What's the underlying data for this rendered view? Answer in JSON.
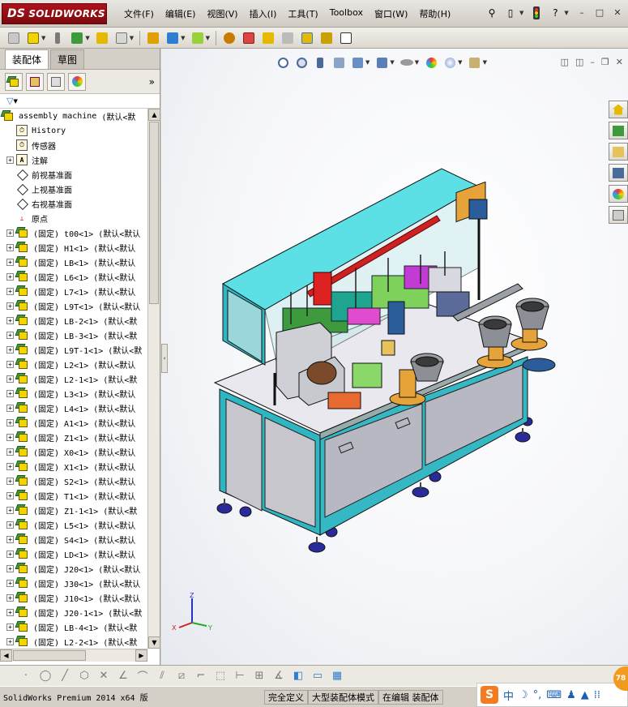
{
  "app": {
    "brand": "SOLIDWORKS",
    "brand_prefix": "DS"
  },
  "menu": [
    "文件(F)",
    "编辑(E)",
    "视图(V)",
    "插入(I)",
    "工具(T)",
    "Toolbox",
    "窗口(W)",
    "帮助(H)"
  ],
  "window_buttons": [
    "–",
    "□",
    "✕"
  ],
  "tabs": [
    {
      "label": "装配体",
      "active": true
    },
    {
      "label": "草图",
      "active": false
    }
  ],
  "tree": {
    "root": {
      "name": "assembly machine",
      "config": "(默认<默"
    },
    "items": [
      {
        "kind": "folder",
        "expand": false,
        "label": "History"
      },
      {
        "kind": "folder",
        "expand": false,
        "label": "传感器"
      },
      {
        "kind": "annot",
        "expand": true,
        "label": "注解"
      },
      {
        "kind": "plane",
        "expand": false,
        "label": "前视基准面"
      },
      {
        "kind": "plane",
        "expand": false,
        "label": "上视基准面"
      },
      {
        "kind": "plane",
        "expand": false,
        "label": "右视基准面"
      },
      {
        "kind": "origin",
        "expand": false,
        "label": "原点"
      },
      {
        "kind": "part",
        "expand": true,
        "label": "(固定) t00<1> (默认<默认"
      },
      {
        "kind": "part",
        "expand": true,
        "label": "(固定) H1<1> (默认<默认"
      },
      {
        "kind": "part",
        "expand": true,
        "label": "(固定) LB<1> (默认<默认"
      },
      {
        "kind": "part",
        "expand": true,
        "label": "(固定) L6<1> (默认<默认"
      },
      {
        "kind": "part",
        "expand": true,
        "label": "(固定) L7<1> (默认<默认"
      },
      {
        "kind": "part",
        "expand": true,
        "label": "(固定) L9T<1> (默认<默认"
      },
      {
        "kind": "part",
        "expand": true,
        "label": "(固定) LB-2<1> (默认<默"
      },
      {
        "kind": "part",
        "expand": true,
        "label": "(固定) LB-3<1> (默认<默"
      },
      {
        "kind": "part",
        "expand": true,
        "label": "(固定) L9T-1<1> (默认<默"
      },
      {
        "kind": "part",
        "expand": true,
        "label": "(固定) L2<1> (默认<默认"
      },
      {
        "kind": "part",
        "expand": true,
        "label": "(固定) L2-1<1> (默认<默"
      },
      {
        "kind": "part",
        "expand": true,
        "label": "(固定) L3<1> (默认<默认"
      },
      {
        "kind": "part",
        "expand": true,
        "label": "(固定) L4<1> (默认<默认"
      },
      {
        "kind": "part",
        "expand": true,
        "label": "(固定) A1<1> (默认<默认"
      },
      {
        "kind": "part",
        "expand": true,
        "label": "(固定) Z1<1> (默认<默认"
      },
      {
        "kind": "part",
        "expand": true,
        "label": "(固定) X0<1> (默认<默认"
      },
      {
        "kind": "part",
        "expand": true,
        "label": "(固定) X1<1> (默认<默认"
      },
      {
        "kind": "part",
        "expand": true,
        "label": "(固定) S2<1> (默认<默认"
      },
      {
        "kind": "part",
        "expand": true,
        "label": "(固定) T1<1> (默认<默认"
      },
      {
        "kind": "part",
        "expand": true,
        "label": "(固定) Z1-1<1> (默认<默"
      },
      {
        "kind": "part",
        "expand": true,
        "label": "(固定) L5<1> (默认<默认"
      },
      {
        "kind": "part",
        "expand": true,
        "label": "(固定) S4<1> (默认<默认"
      },
      {
        "kind": "part",
        "expand": true,
        "label": "(固定) LD<1> (默认<默认"
      },
      {
        "kind": "part",
        "expand": true,
        "label": "(固定) J20<1> (默认<默认"
      },
      {
        "kind": "part",
        "expand": true,
        "label": "(固定) J30<1> (默认<默认"
      },
      {
        "kind": "part",
        "expand": true,
        "label": "(固定) J10<1> (默认<默认"
      },
      {
        "kind": "part",
        "expand": true,
        "label": "(固定) J20-1<1> (默认<默"
      },
      {
        "kind": "part",
        "expand": true,
        "label": "(固定) LB-4<1> (默认<默"
      },
      {
        "kind": "part",
        "expand": true,
        "label": "(固定) L2-2<1> (默认<默"
      }
    ]
  },
  "triad": {
    "x": "X",
    "y": "Y",
    "z": "Z"
  },
  "status": {
    "product": "SolidWorks Premium 2014 x64 版",
    "definition": "完全定义",
    "mode": "大型装配体模式",
    "editing": "在编辑 装配体"
  },
  "ime": {
    "letter": "S",
    "lang": "中",
    "badge": "78"
  },
  "colors": {
    "brand_red": "#b0121a",
    "cube_yellow": "#f1d400",
    "cube_green": "#3d9b3d",
    "machine_cyan": "#5ce0e6",
    "cabinet_grey": "#b8b8c2"
  }
}
